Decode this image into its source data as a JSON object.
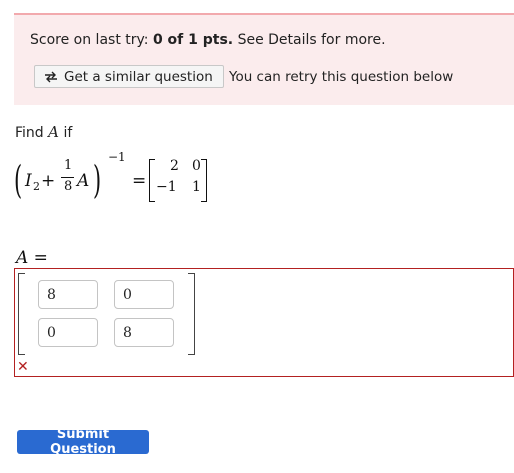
{
  "score": {
    "prefix": "Score on last try:",
    "value": "0 of 1 pts.",
    "suffix": "See Details for more."
  },
  "similar_button": {
    "label": "Get a similar question",
    "icon": "retry-arrows-icon"
  },
  "retry_text": "You can retry this question below",
  "question": {
    "prompt": "Find",
    "variable": "A",
    "suffix": "if",
    "equation": {
      "identity": "I",
      "identity_sub": "2",
      "plus": "+",
      "frac_num": "1",
      "frac_den": "8",
      "var": "A",
      "exponent": "−1",
      "equals": "=",
      "matrix": [
        [
          "2",
          "0"
        ],
        [
          "−1",
          "1"
        ]
      ]
    }
  },
  "answer": {
    "label": "A =",
    "cells": [
      [
        "8",
        "0"
      ],
      [
        "0",
        "8"
      ]
    ],
    "status_icon": "wrong-x-icon",
    "status_glyph": "✕",
    "status_color": "#b32121"
  },
  "submit_button": {
    "label": "Submit Question",
    "color": "#2a6ad1"
  }
}
